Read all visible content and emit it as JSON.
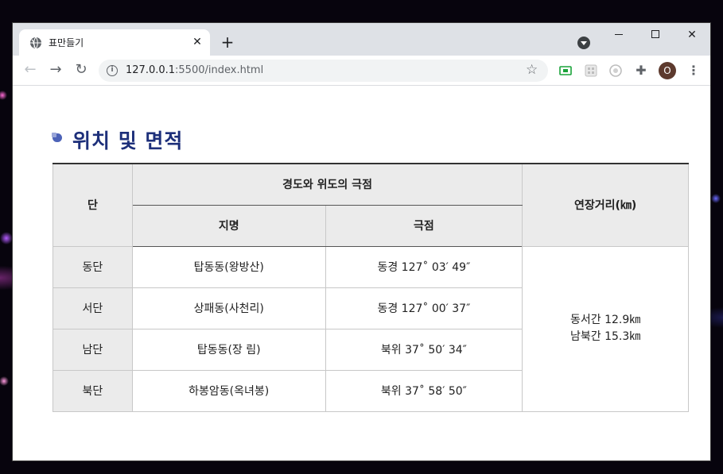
{
  "browser": {
    "tab_title": "표만들기",
    "url_host": "127.0.0.1",
    "url_path": ":5500/index.html",
    "avatar_letter": "O",
    "accent": "#1a73e8"
  },
  "page": {
    "heading": "위치 및 면적",
    "table": {
      "header": {
        "col_direction": "단",
        "group_label": "경도와 위도의 극점",
        "col_place": "지명",
        "col_point": "극점",
        "col_distance": "연장거리(㎞)"
      },
      "rows": [
        {
          "direction": "동단",
          "place": "탑동동(왕방산)",
          "point": "동경 127˚ 03′ 49″"
        },
        {
          "direction": "서단",
          "place": "상패동(사천리)",
          "point": "동경 127˚ 00′ 37″"
        },
        {
          "direction": "남단",
          "place": "탑동동(장 림)",
          "point": "북위 37˚ 50′ 34″"
        },
        {
          "direction": "북단",
          "place": "하봉암동(옥녀봉)",
          "point": "북위 37˚ 58′ 50″"
        }
      ],
      "distance_lines": [
        "동서간 12.9㎞",
        "남북간 15.3㎞"
      ]
    },
    "colors": {
      "heading": "#1d2f7a",
      "header_bg": "#ebebeb"
    }
  }
}
